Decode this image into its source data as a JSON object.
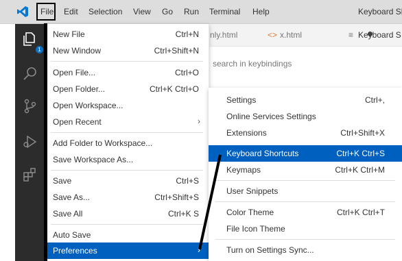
{
  "menubar": {
    "items": [
      "File",
      "Edit",
      "Selection",
      "View",
      "Go",
      "Run",
      "Terminal",
      "Help"
    ],
    "window_title": "Keyboard Sh"
  },
  "activity": {
    "badge": "1"
  },
  "tabs": [
    {
      "label": "nly.html"
    },
    {
      "label": "x.html"
    },
    {
      "label": "Keyboard S"
    }
  ],
  "editor": {
    "search_placeholder": "search in keybindings"
  },
  "file_menu": {
    "items": [
      {
        "label": "New File",
        "shortcut": "Ctrl+N"
      },
      {
        "label": "New Window",
        "shortcut": "Ctrl+Shift+N"
      },
      {
        "label": "Open File...",
        "shortcut": "Ctrl+O"
      },
      {
        "label": "Open Folder...",
        "shortcut": "Ctrl+K Ctrl+O"
      },
      {
        "label": "Open Workspace...",
        "shortcut": ""
      },
      {
        "label": "Open Recent",
        "shortcut": ""
      },
      {
        "label": "Add Folder to Workspace...",
        "shortcut": ""
      },
      {
        "label": "Save Workspace As...",
        "shortcut": ""
      },
      {
        "label": "Save",
        "shortcut": "Ctrl+S"
      },
      {
        "label": "Save As...",
        "shortcut": "Ctrl+Shift+S"
      },
      {
        "label": "Save All",
        "shortcut": "Ctrl+K S"
      },
      {
        "label": "Auto Save",
        "shortcut": ""
      },
      {
        "label": "Preferences",
        "shortcut": ""
      }
    ]
  },
  "pref_menu": {
    "items": [
      {
        "label": "Settings",
        "shortcut": "Ctrl+,"
      },
      {
        "label": "Online Services Settings",
        "shortcut": ""
      },
      {
        "label": "Extensions",
        "shortcut": "Ctrl+Shift+X"
      },
      {
        "label": "Keyboard Shortcuts",
        "shortcut": "Ctrl+K Ctrl+S"
      },
      {
        "label": "Keymaps",
        "shortcut": "Ctrl+K Ctrl+M"
      },
      {
        "label": "User Snippets",
        "shortcut": ""
      },
      {
        "label": "Color Theme",
        "shortcut": "Ctrl+K Ctrl+T"
      },
      {
        "label": "File Icon Theme",
        "shortcut": ""
      },
      {
        "label": "Turn on Settings Sync...",
        "shortcut": ""
      }
    ]
  },
  "colors": {
    "highlight": "#0060c0",
    "activity_bar": "#2c2c2c",
    "menubar": "#dddddd",
    "logo": "#0078d4"
  }
}
